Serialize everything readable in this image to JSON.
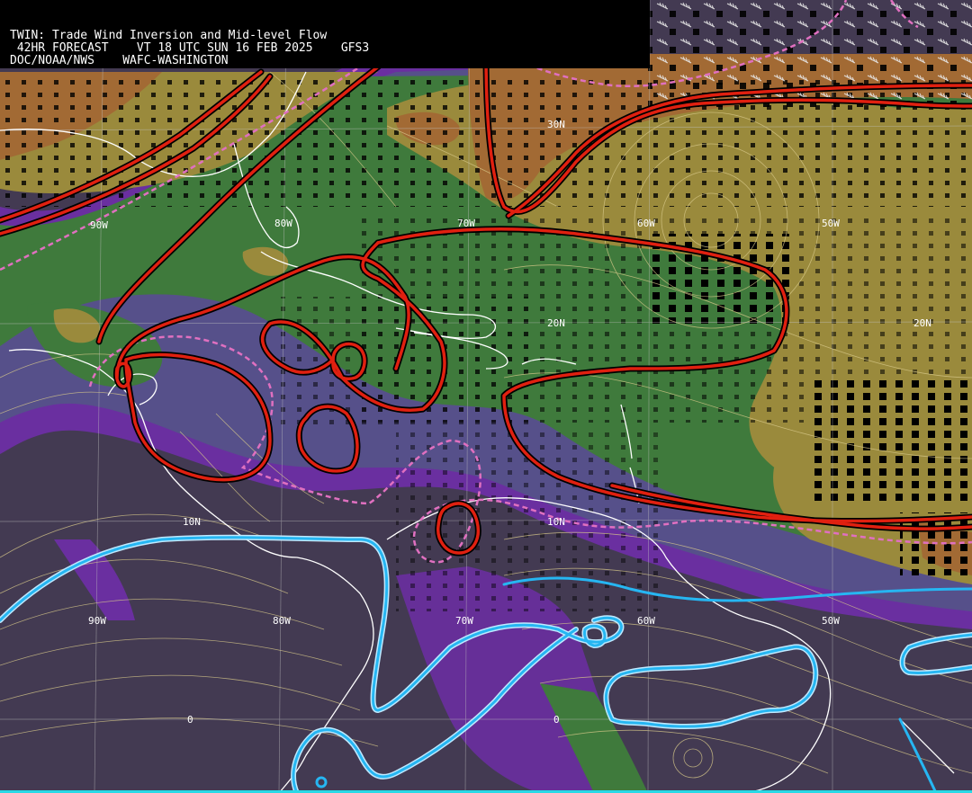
{
  "header": {
    "line1": "TWIN: Trade Wind Inversion and Mid-level Flow",
    "line2": " 42HR FORECAST    VT 18 UTC SUN 16 FEB 2025    GFS3",
    "line3": "DOC/NOAA/NWS    WAFC-WASHINGTON"
  },
  "map": {
    "lon_labels_north": [
      "90W",
      "80W",
      "70W",
      "60W",
      "50W"
    ],
    "lon_labels_south": [
      "90W",
      "80W",
      "70W",
      "60W",
      "50W"
    ],
    "lat_labels": [
      "30N",
      "20N",
      "20N",
      "10N",
      "10N",
      "0",
      "0"
    ],
    "colors": {
      "background": "#433a52",
      "purple": "#6a2fa0",
      "slate": "#56508a",
      "green": "#3f7a3c",
      "olive": "#9a8a3c",
      "brown": "#a26a34",
      "inversion_contour": "#e02010",
      "dashed_contour": "#e070c0",
      "cyan_contour": "#26b6f2",
      "coastline": "#ffffff",
      "streamline": "#d8c98a",
      "grid": "#c0c0c0"
    }
  }
}
